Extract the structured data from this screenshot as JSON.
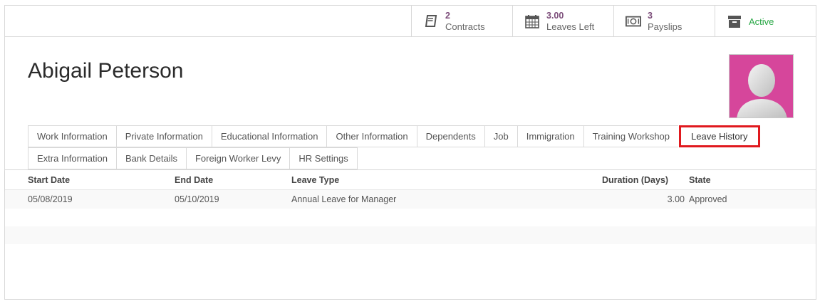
{
  "smart_buttons": [
    {
      "value": "2",
      "label": "Contracts",
      "icon": "book-icon"
    },
    {
      "value": "3.00",
      "label": "Leaves Left",
      "icon": "calendar-icon"
    },
    {
      "value": "3",
      "label": "Payslips",
      "icon": "money-icon"
    },
    {
      "label": "Active",
      "icon": "archive-icon"
    }
  ],
  "employee": {
    "name": "Abigail Peterson"
  },
  "tabs_row1": [
    "Work Information",
    "Private Information",
    "Educational Information",
    "Other Information",
    "Dependents",
    "Job",
    "Immigration",
    "Training Workshop",
    "Leave History"
  ],
  "tabs_row2": [
    "Extra Information",
    "Bank Details",
    "Foreign Worker Levy",
    "HR Settings"
  ],
  "active_tab": "Leave History",
  "table": {
    "headers": [
      "Start Date",
      "End Date",
      "Leave Type",
      "Duration (Days)",
      "State"
    ],
    "rows": [
      [
        "05/08/2019",
        "05/10/2019",
        "Annual Leave for Manager",
        "3.00",
        "Approved"
      ]
    ]
  },
  "colors": {
    "accent": "#7c4d7a",
    "active_status": "#28a745",
    "avatar_bg": "#d6469b",
    "highlight": "#e0191e"
  }
}
